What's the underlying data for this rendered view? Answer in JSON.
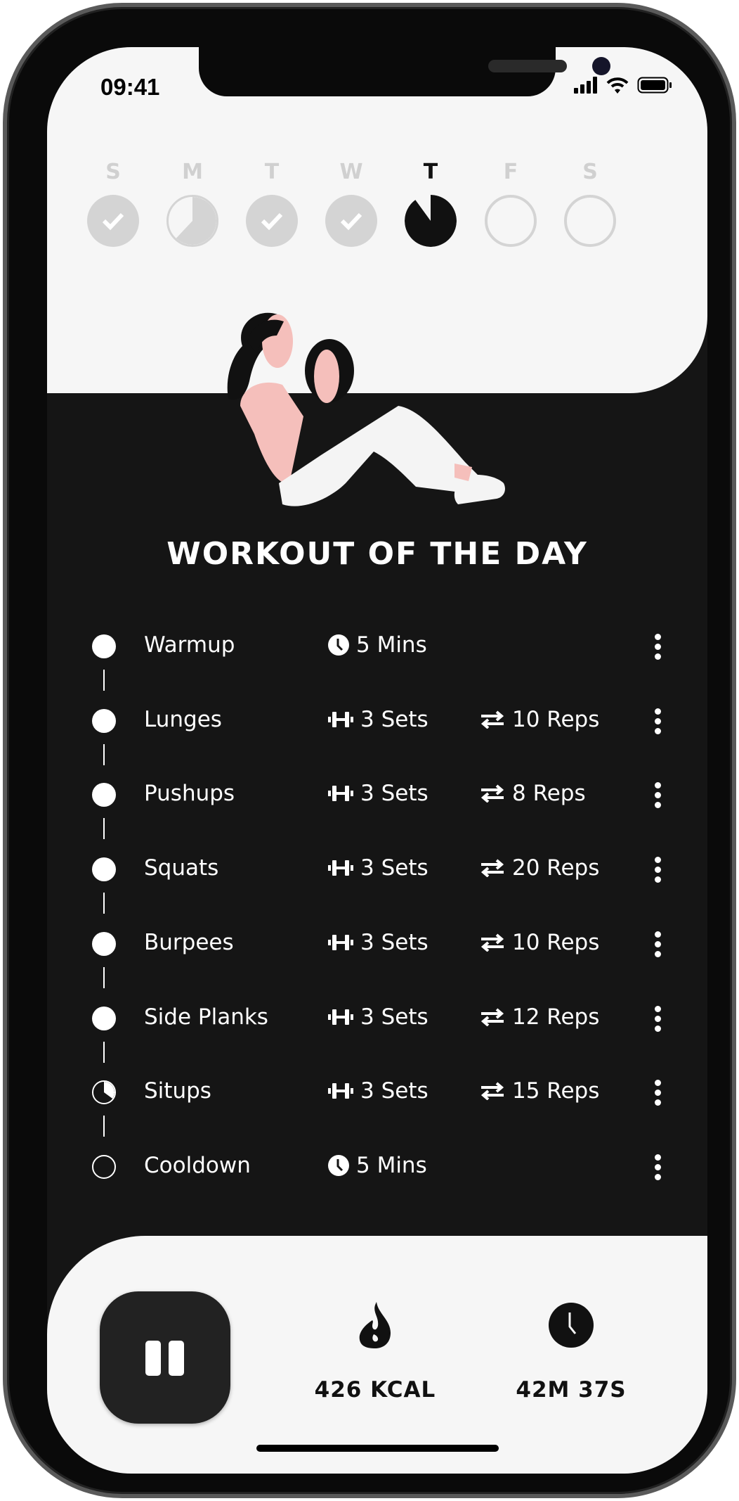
{
  "status_bar": {
    "time": "09:41"
  },
  "week": [
    {
      "letter": "S",
      "state": "done"
    },
    {
      "letter": "M",
      "state": "partial",
      "progress": 0.62
    },
    {
      "letter": "T",
      "state": "done"
    },
    {
      "letter": "W",
      "state": "done"
    },
    {
      "letter": "T",
      "state": "current",
      "progress": 0.9
    },
    {
      "letter": "F",
      "state": "empty"
    },
    {
      "letter": "S",
      "state": "empty"
    }
  ],
  "title": "WORKOUT OF THE DAY",
  "exercises": [
    {
      "name": "Warmup",
      "type": "time",
      "duration": "5 Mins",
      "status": "done"
    },
    {
      "name": "Lunges",
      "sets": "3 Sets",
      "reps": "10 Reps",
      "status": "done"
    },
    {
      "name": "Pushups",
      "sets": "3 Sets",
      "reps": "8 Reps",
      "status": "done"
    },
    {
      "name": "Squats",
      "sets": "3 Sets",
      "reps": "20 Reps",
      "status": "done"
    },
    {
      "name": "Burpees",
      "sets": "3 Sets",
      "reps": "10 Reps",
      "status": "done"
    },
    {
      "name": "Side Planks",
      "sets": "3 Sets",
      "reps": "12 Reps",
      "status": "done"
    },
    {
      "name": "Situps",
      "sets": "3 Sets",
      "reps": "15 Reps",
      "status": "partial",
      "progress": 0.35
    },
    {
      "name": "Cooldown",
      "type": "time",
      "duration": "5 Mins",
      "status": "pending"
    }
  ],
  "footer": {
    "calories": "426 KCAL",
    "elapsed": "42M 37S"
  },
  "colors": {
    "dark": "#151515",
    "light": "#f6f6f6",
    "done_gray": "#d4d4d4",
    "skin": "#f5bfbb"
  }
}
